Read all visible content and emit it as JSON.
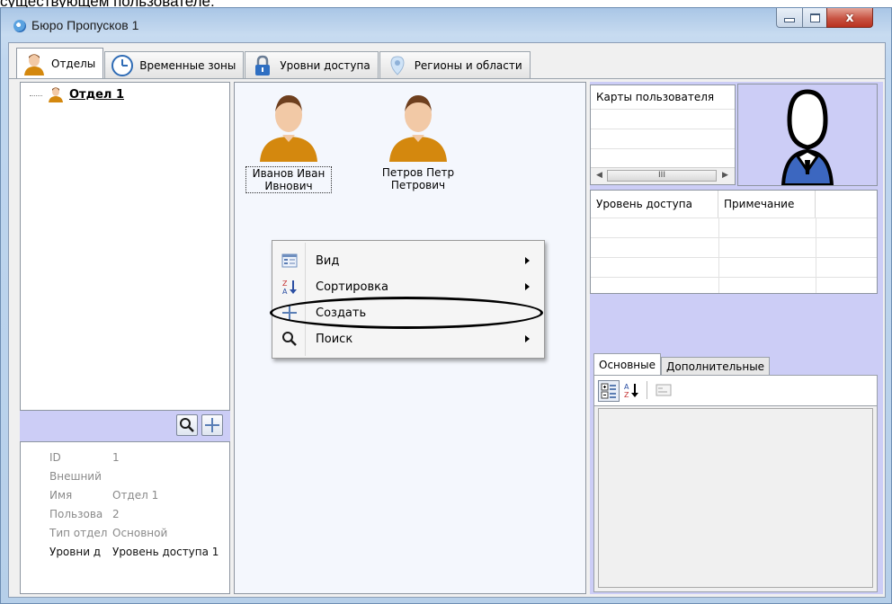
{
  "page_caption": "существующем пользователе.",
  "window": {
    "title": "Бюро Пропусков 1",
    "controls": {
      "close": "x"
    }
  },
  "tabs": [
    {
      "label": "Отделы",
      "icon": "person-icon",
      "active": true
    },
    {
      "label": "Временные зоны",
      "icon": "clock-icon",
      "active": false
    },
    {
      "label": "Уровни доступа",
      "icon": "lock-icon",
      "active": false
    },
    {
      "label": "Регионы и области",
      "icon": "region-icon",
      "active": false
    }
  ],
  "tree": {
    "root": {
      "label": "Отдел 1",
      "icon": "person-icon"
    }
  },
  "left_toolbar": {
    "search": {
      "icon": "search-icon"
    },
    "add": {
      "icon": "plus-icon"
    }
  },
  "department_properties": [
    {
      "key": "ID",
      "value": "1"
    },
    {
      "key": "Внешний",
      "value": ""
    },
    {
      "key": "Имя",
      "value": "Отдел 1"
    },
    {
      "key": "Пользова",
      "value": "2"
    },
    {
      "key": "Тип отдел",
      "value": "Основной"
    },
    {
      "key": "Уровни д",
      "value": "Уровень доступа 1"
    }
  ],
  "users": [
    {
      "line1": "Иванов Иван",
      "line2": "Ивнович",
      "selected": true
    },
    {
      "line1": "Петров Петр",
      "line2": "Петрович",
      "selected": false
    }
  ],
  "context_menu": {
    "items": [
      {
        "label": "Вид",
        "icon": "view-icon",
        "submenu": true
      },
      {
        "label": "Сортировка",
        "icon": "sort-az-icon",
        "submenu": true
      },
      {
        "label": "Создать",
        "icon": "plus-icon",
        "submenu": false,
        "highlighted_by_annotation": true
      },
      {
        "label": "Поиск",
        "icon": "search-icon",
        "submenu": true
      }
    ]
  },
  "cards_panel": {
    "header": "Карты пользователя",
    "scroll_thumb": "III"
  },
  "access_table": {
    "columns": [
      "Уровень доступа",
      "Примечание"
    ]
  },
  "properties_panel": {
    "tabs": [
      "Основные",
      "Дополнительные"
    ],
    "toolbar": [
      {
        "icon": "categorized-icon"
      },
      {
        "icon": "sort-alpha-icon"
      },
      {
        "icon": "property-pages-icon"
      }
    ]
  },
  "colors": {
    "accent_panel": "#cccdf6",
    "person_body": "#d4880e",
    "ellipse": "#000000"
  }
}
